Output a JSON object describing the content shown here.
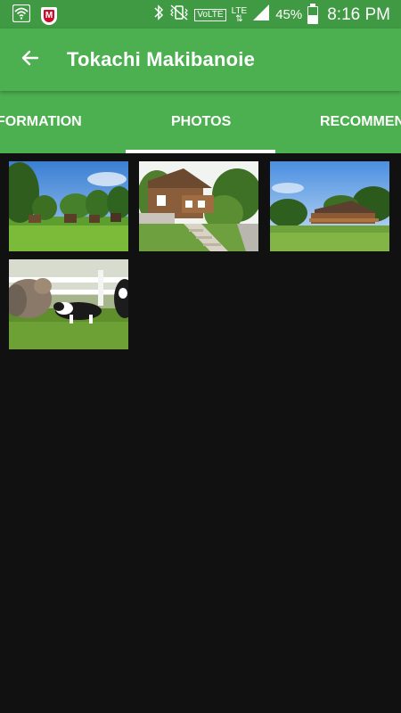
{
  "status_bar": {
    "volte_label": "VoLTE",
    "lte_label": "LTE",
    "battery_percent": "45%",
    "battery_level": 0.45,
    "time": "8:16 PM"
  },
  "app_bar": {
    "title": "Tokachi Makibanoie",
    "back_icon": "arrow-left-icon"
  },
  "tabs": [
    {
      "label": "INFORMATION",
      "selected": false
    },
    {
      "label": "PHOTOS",
      "selected": true
    },
    {
      "label": "RECOMMENDED",
      "selected": false
    }
  ],
  "photos": [
    {
      "subject": "cabins on lawn with trees"
    },
    {
      "subject": "log house with stone steps"
    },
    {
      "subject": "lodge with wooden deck"
    },
    {
      "subject": "sheepdog with sheep"
    }
  ],
  "colors": {
    "status_bar": "#3f9a43",
    "app_bar": "#4caf50",
    "background": "#111111",
    "tab_indicator": "#ffffff"
  }
}
